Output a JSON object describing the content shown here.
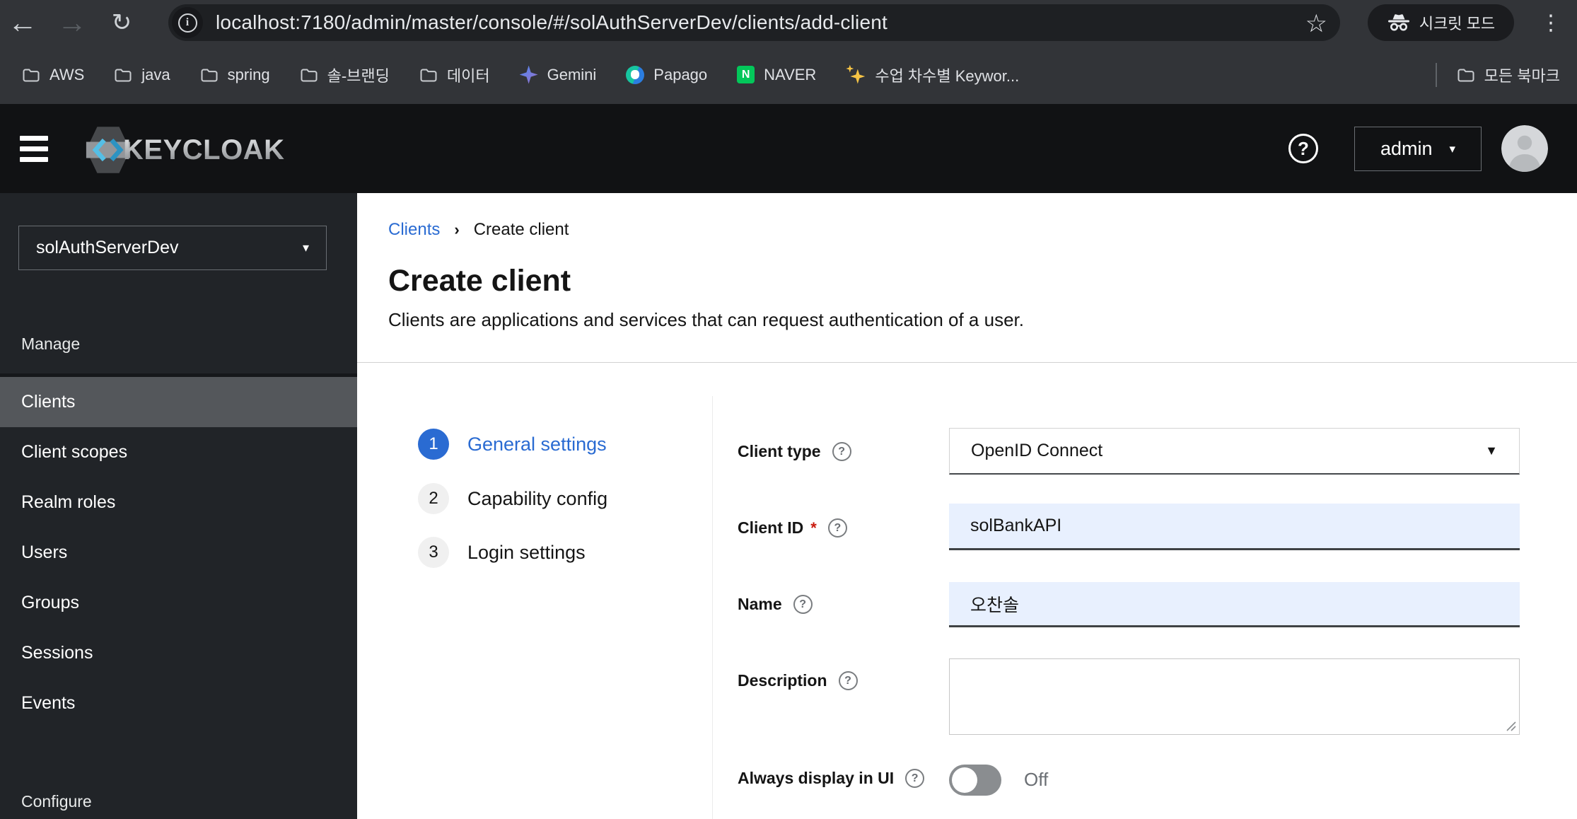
{
  "browser": {
    "url": "localhost:7180/admin/master/console/#/solAuthServerDev/clients/add-client",
    "secret_mode_label": "시크릿 모드",
    "info_glyph": "i",
    "bookmarks": [
      {
        "label": "AWS"
      },
      {
        "label": "java"
      },
      {
        "label": "spring"
      },
      {
        "label": "솔-브랜딩"
      },
      {
        "label": "데이터"
      },
      {
        "label": "Gemini"
      },
      {
        "label": "Papago"
      },
      {
        "label": "NAVER"
      },
      {
        "label": "수업 차수별 Keywor..."
      }
    ],
    "naver_letter": "N",
    "all_bookmarks_label": "모든 북마크"
  },
  "header": {
    "brand": "KEYCLOAK",
    "help_glyph": "?",
    "user": "admin"
  },
  "sidebar": {
    "realm": "solAuthServerDev",
    "manage_title": "Manage",
    "configure_title": "Configure",
    "items": [
      "Clients",
      "Client scopes",
      "Realm roles",
      "Users",
      "Groups",
      "Sessions",
      "Events"
    ]
  },
  "main": {
    "breadcrumb": {
      "parent": "Clients",
      "current": "Create client"
    },
    "title": "Create client",
    "subtitle": "Clients are applications and services that can request authentication of a user.",
    "wizard": [
      {
        "num": "1",
        "label": "General settings"
      },
      {
        "num": "2",
        "label": "Capability config"
      },
      {
        "num": "3",
        "label": "Login settings"
      }
    ],
    "form": {
      "client_type": {
        "label": "Client type",
        "value": "OpenID Connect"
      },
      "client_id": {
        "label": "Client ID",
        "required": "*",
        "value": "solBankAPI"
      },
      "name": {
        "label": "Name",
        "value": "오찬솔"
      },
      "description": {
        "label": "Description",
        "value": ""
      },
      "always_display": {
        "label": "Always display in UI",
        "state": "Off"
      }
    }
  },
  "colors": {
    "accent": "#2a6bd2",
    "autofill_bg": "#e8f0fe",
    "naver_green": "#03c75a"
  }
}
